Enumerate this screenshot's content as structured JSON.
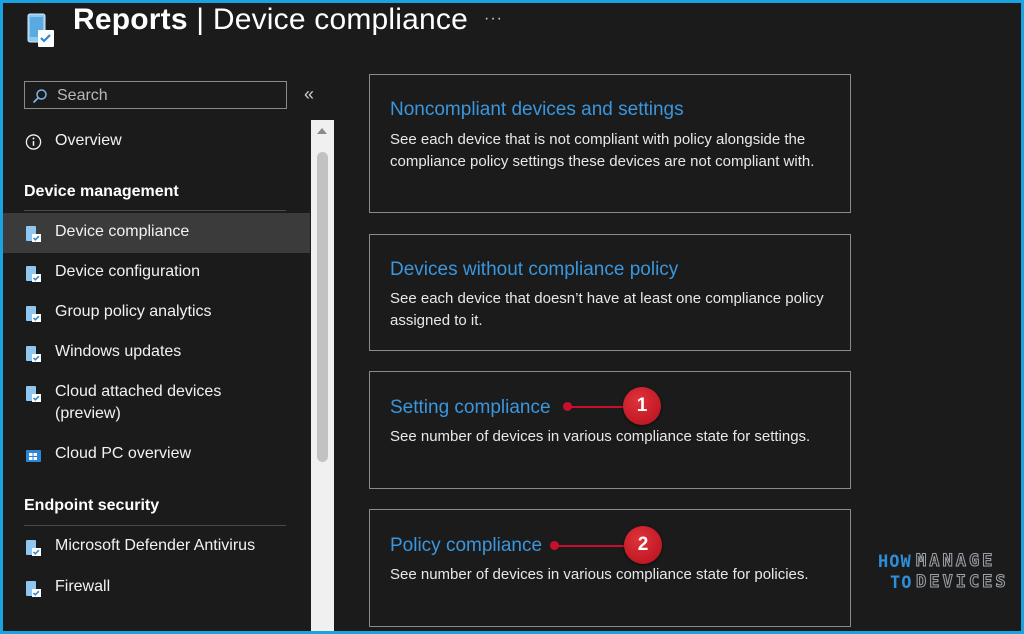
{
  "header": {
    "title_bold": "Reports",
    "title_sep": " | ",
    "title_rest": "Device compliance",
    "more": "···",
    "icon": "device-compliance-icon"
  },
  "sidebar": {
    "search": {
      "placeholder": "Search",
      "value": ""
    },
    "collapse": "«",
    "overview": {
      "label": "Overview",
      "icon": "info-circle-icon"
    },
    "sections": [
      {
        "title": "Device management",
        "items": [
          {
            "label": "Device compliance",
            "icon": "device-compliance-icon",
            "selected": true
          },
          {
            "label": "Device configuration",
            "icon": "device-configuration-icon"
          },
          {
            "label": "Group policy analytics",
            "icon": "group-policy-icon"
          },
          {
            "label": "Windows updates",
            "icon": "windows-updates-icon"
          },
          {
            "label": "Cloud attached devices (preview)",
            "icon": "cloud-attached-icon"
          },
          {
            "label": "Cloud PC overview",
            "icon": "cloud-pc-icon"
          }
        ]
      },
      {
        "title": "Endpoint security",
        "items": [
          {
            "label": "Microsoft Defender Antivirus",
            "icon": "defender-icon"
          },
          {
            "label": "Firewall",
            "icon": "firewall-icon"
          }
        ]
      }
    ]
  },
  "cards": [
    {
      "title": "Noncompliant devices and settings",
      "description": "See each device that is not compliant with policy alongside the compliance policy settings these devices are not compliant with."
    },
    {
      "title": "Devices without compliance policy",
      "description": "See each device that doesn’t have at least one compliance policy assigned to it."
    },
    {
      "title": "Setting compliance",
      "description": "See number of devices in various compliance state for settings.",
      "callout": "1"
    },
    {
      "title": "Policy compliance",
      "description": "See number of devices in various compliance state for policies.",
      "callout": "2"
    }
  ],
  "logo": {
    "line1a": "HOW",
    "line1b": "MANAGE",
    "line2a": "TO",
    "line2b": "DEVICES"
  },
  "colors": {
    "link": "#3a96dd",
    "callout": "#c8102e",
    "frame": "#1aa3e0",
    "background": "#1b1b1b"
  }
}
